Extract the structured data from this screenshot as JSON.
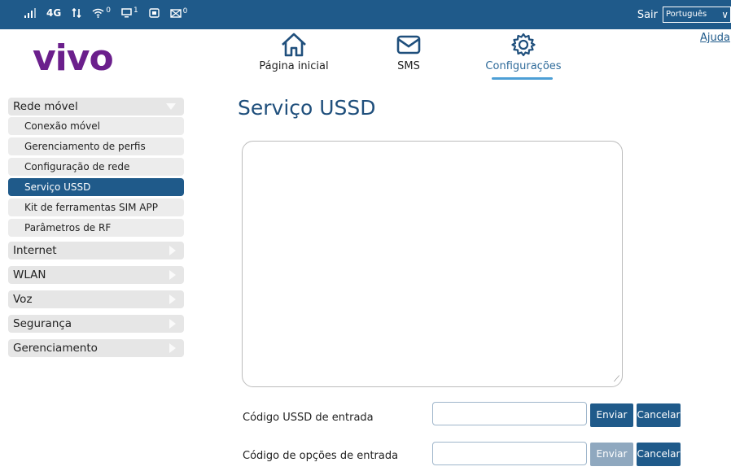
{
  "statusbar": {
    "network": "4G",
    "wifi_count": "0",
    "device_count": "1",
    "sms_count": "0",
    "sair": "Sair",
    "language": "Português"
  },
  "header": {
    "logo": "vivo",
    "nav": [
      {
        "label": "Página inicial",
        "icon": "home-icon"
      },
      {
        "label": "SMS",
        "icon": "envelope-icon"
      },
      {
        "label": "Configurações",
        "icon": "gear-icon",
        "active": true
      }
    ],
    "help": "Ajuda"
  },
  "sidebar": {
    "groups": [
      {
        "label": "Rede móvel",
        "expanded": true,
        "items": [
          "Conexão móvel",
          "Gerenciamento de perfis",
          "Configuração de rede",
          "Serviço USSD",
          "Kit de ferramentas SIM APP",
          "Parâmetros de RF"
        ],
        "active_item": "Serviço USSD"
      },
      {
        "label": "Internet"
      },
      {
        "label": "WLAN"
      },
      {
        "label": "Voz"
      },
      {
        "label": "Segurança"
      },
      {
        "label": "Gerenciamento"
      }
    ]
  },
  "main": {
    "title": "Serviço USSD",
    "output_text": "",
    "ussd_code_label": "Código USSD de entrada",
    "ussd_code_value": "",
    "options_code_label": "Código de opções de entrada",
    "options_code_value": "",
    "send_label": "Enviar",
    "cancel_label": "Cancelar"
  },
  "colors": {
    "primary": "#1f5a8a",
    "brand": "#6b1f8c",
    "accent": "#4d9fd6"
  }
}
